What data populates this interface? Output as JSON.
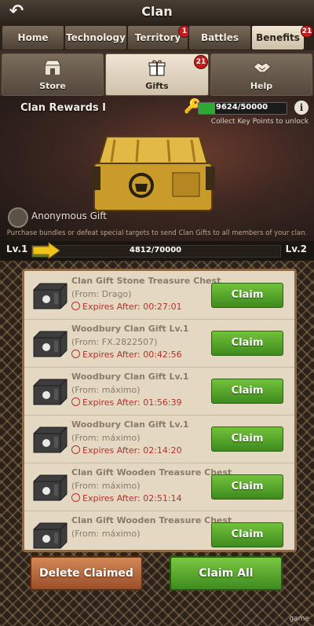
{
  "header": {
    "title": "Clan",
    "back_icon": "back-arrow-icon"
  },
  "tabs": [
    {
      "label": "Home",
      "badge": ""
    },
    {
      "label": "Technology",
      "badge": ""
    },
    {
      "label": "Territory",
      "badge": "1"
    },
    {
      "label": "Battles",
      "badge": ""
    },
    {
      "label": "Benefits",
      "badge": "21",
      "active": true
    }
  ],
  "subtabs": [
    {
      "label": "Store",
      "icon": "store-icon"
    },
    {
      "label": "Gifts",
      "icon": "gift-icon",
      "badge": "21",
      "active": true
    },
    {
      "label": "Help",
      "icon": "handshake-icon"
    }
  ],
  "rewards": {
    "title": "Clan Rewards I",
    "key_points": "9624/50000",
    "key_progress": 0.19,
    "collect_text": "Collect Key Points to unlock",
    "anonymous_label": "Anonymous Gift",
    "hint": "Purchase bundles or defeat special targets to send Clan Gifts to all members of your clan."
  },
  "level": {
    "left": "Lv.1",
    "right": "Lv.2",
    "progress_text": "4812/70000",
    "progress": 0.069
  },
  "gifts": [
    {
      "name": "Clan Gift Stone Treasure Chest",
      "from": "(From: Drago)",
      "expires": "Expires After: 00:27:01",
      "claim": "Claim"
    },
    {
      "name": "Woodbury Clan Gift Lv.1",
      "from": "(From: FX.2822507)",
      "expires": "Expires After: 00:42:56",
      "claim": "Claim"
    },
    {
      "name": "Woodbury Clan Gift Lv.1",
      "from": "(From: máximo)",
      "expires": "Expires After: 01:56:39",
      "claim": "Claim"
    },
    {
      "name": "Woodbury Clan Gift Lv.1",
      "from": "(From: máximo)",
      "expires": "Expires After: 02:14:20",
      "claim": "Claim"
    },
    {
      "name": "Clan Gift Wooden Treasure Chest",
      "from": "(From: máximo)",
      "expires": "Expires After: 02:51:14",
      "claim": "Claim"
    },
    {
      "name": "Clan Gift Wooden Treasure Chest",
      "from": "(From: máximo)",
      "expires": "",
      "claim": "Claim"
    }
  ],
  "buttons": {
    "delete_claimed": "Delete Claimed",
    "claim_all": "Claim All"
  },
  "watermark": "game"
}
